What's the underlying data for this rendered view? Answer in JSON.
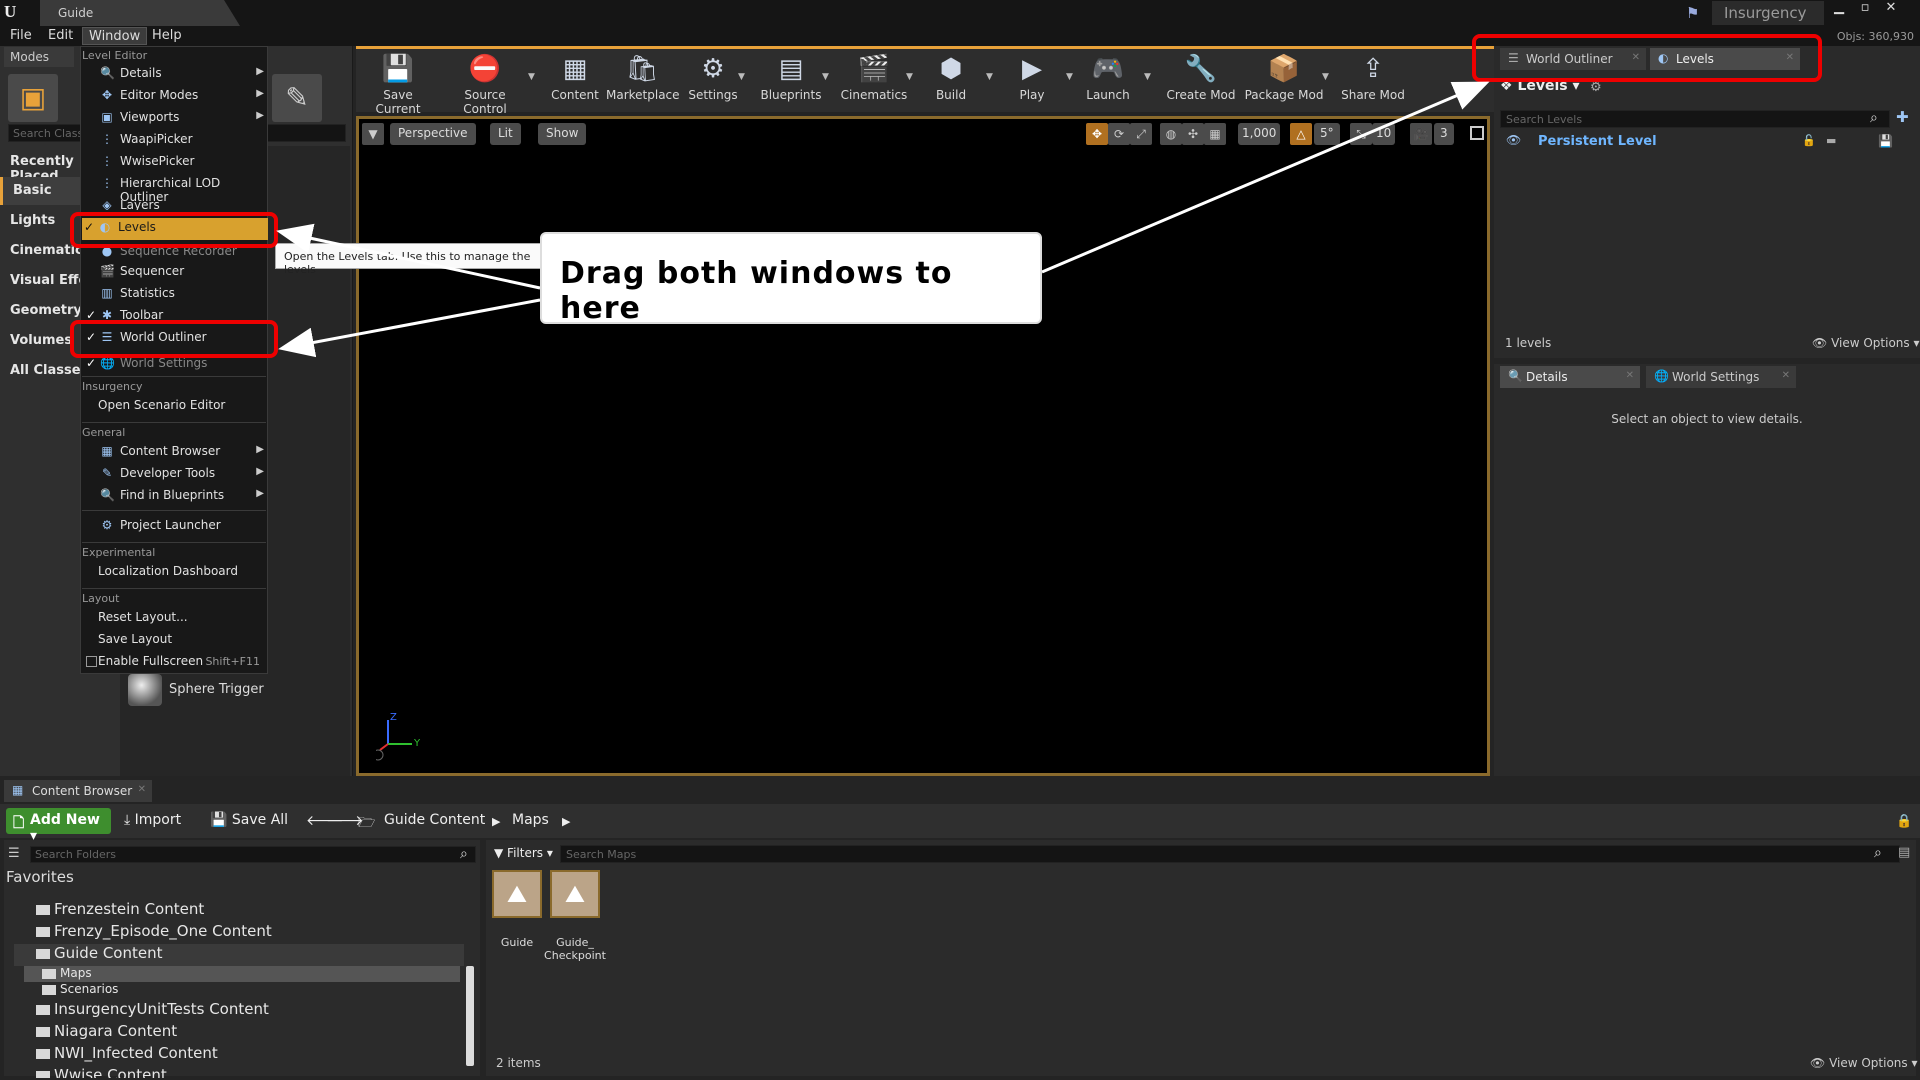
{
  "title_bar": {
    "doc_tab": "Guide",
    "project": "Insurgency",
    "status": "Objs: 360,930",
    "win_min": "▁",
    "win_max": "▫",
    "win_close": "✕"
  },
  "menu": [
    "File",
    "Edit",
    "Window",
    "Help"
  ],
  "modes": {
    "tab": "Modes",
    "search_placeholder": "Search Classes",
    "categories": [
      "Recently Placed",
      "Basic",
      "Lights",
      "Cinematic",
      "Visual Effects",
      "Geometry",
      "Volumes",
      "All Classes"
    ],
    "item": "Sphere Trigger"
  },
  "toolbar": [
    "Save Current",
    "Source Control",
    "Content",
    "Marketplace",
    "Settings",
    "Blueprints",
    "Cinematics",
    "Build",
    "Play",
    "Launch",
    "Create Mod",
    "Package Mod",
    "Share Mod"
  ],
  "viewport": {
    "perspective": "Perspective",
    "lit": "Lit",
    "show": "Show",
    "grid_size": "1,000",
    "rot_snap": "5°",
    "scale_snap": "10",
    "cam_speed": "3",
    "axis_x": "Z",
    "axis_y": "Y"
  },
  "right_top": {
    "tabs": [
      "World Outliner",
      "Levels"
    ],
    "header": "Levels",
    "search_placeholder": "Search Levels",
    "level": "Persistent Level",
    "count": "1 levels",
    "view_options": "View Options"
  },
  "right_bottom": {
    "tabs": [
      "Details",
      "World Settings"
    ],
    "message": "Select an object to view details."
  },
  "content_browser": {
    "tab": "Content Browser",
    "add_new": "Add New",
    "import": "Import",
    "save_all": "Save All",
    "breadcrumb": [
      "Guide Content",
      "Maps"
    ],
    "search_folders": "Search Folders",
    "favorites": "Favorites",
    "tree": [
      "Frenzestein Content",
      "Frenzy_Episode_One Content",
      "Guide Content",
      "InsurgencyUnitTests Content",
      "Niagara Content",
      "NWI_Infected Content",
      "Wwise Content"
    ],
    "sub_tree": [
      "Maps",
      "Scenarios"
    ],
    "filters": "Filters",
    "search_maps": "Search Maps",
    "assets": [
      {
        "name": "Guide"
      },
      {
        "name": "Guide_ Checkpoint Security"
      }
    ],
    "items": "2 items",
    "view_options": "View Options"
  },
  "window_menu": {
    "section_level_editor": "Level Editor",
    "level_editor_items": [
      "Details",
      "Editor Modes",
      "Viewports",
      "WaapiPicker",
      "WwisePicker",
      "Hierarchical LOD Outliner",
      "Layers",
      "Levels",
      "Sequence Recorder",
      "Sequencer",
      "Statistics",
      "Toolbar",
      "World Outliner",
      "World Settings"
    ],
    "section_insurgency": "Insurgency",
    "open_scenario": "Open Scenario Editor",
    "section_general": "General",
    "general_items": [
      "Content Browser",
      "Developer Tools",
      "Find in Blueprints"
    ],
    "project_launcher": "Project Launcher",
    "section_experimental": "Experimental",
    "localization": "Localization Dashboard",
    "section_layout": "Layout",
    "reset_layout": "Reset Layout...",
    "save_layout": "Save Layout",
    "fullscreen": "Enable Fullscreen",
    "fullscreen_shortcut": "Shift+F11",
    "tooltip": "Open the Levels tab. Use this to manage the levels"
  },
  "annotation": {
    "callout": "Drag both windows to here"
  },
  "colors": {
    "accent": "#e8a23a",
    "annotation_red": "#ee0000",
    "level_blue": "#6fb6ff",
    "add_new_green": "#3e8e2e"
  }
}
